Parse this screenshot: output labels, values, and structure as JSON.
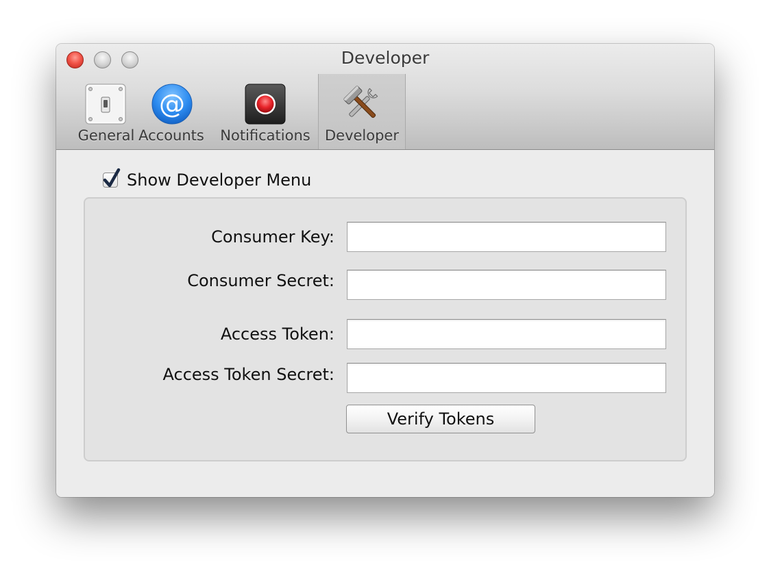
{
  "window": {
    "title": "Developer"
  },
  "toolbar": {
    "tabs": [
      {
        "label": "General",
        "icon": "light-switch-icon"
      },
      {
        "label": "Accounts",
        "icon": "at-sign-icon"
      },
      {
        "label": "Notifications",
        "icon": "record-icon"
      },
      {
        "label": "Developer",
        "icon": "hammer-wrench-icon",
        "selected": true
      }
    ]
  },
  "developer": {
    "show_menu_label": "Show Developer Menu",
    "show_menu_checked": true,
    "fields": {
      "consumer_key": {
        "label": "Consumer Key:",
        "value": ""
      },
      "consumer_secret": {
        "label": "Consumer Secret:",
        "value": ""
      },
      "access_token": {
        "label": "Access Token:",
        "value": ""
      },
      "access_token_secret": {
        "label": "Access Token Secret:",
        "value": ""
      }
    },
    "verify_label": "Verify Tokens"
  },
  "colors": {
    "close": "#f2554a",
    "accent_blue": "#1f7ae0",
    "record_red": "#e8242a"
  }
}
